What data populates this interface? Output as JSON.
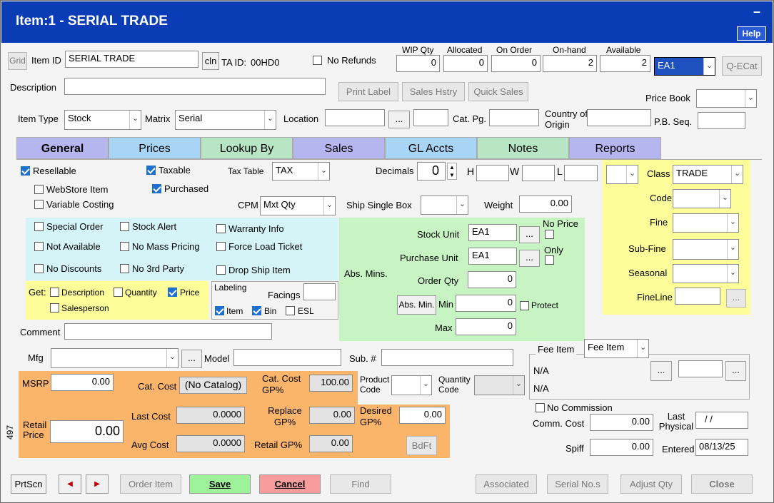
{
  "window": {
    "title": "Item:1 - SERIAL TRADE",
    "minimize": "–",
    "help": "Help"
  },
  "header": {
    "grid": "Grid",
    "item_id_label": "Item ID",
    "item_id": "SERIAL TRADE",
    "cln": "cln",
    "ta_id_label": "TA ID:",
    "ta_id": "00HD0",
    "no_refunds": "No Refunds",
    "description_label": "Description",
    "description": "",
    "item_type_label": "Item Type",
    "item_type": "Stock",
    "matrix_label": "Matrix",
    "matrix": "Serial",
    "location_label": "Location",
    "location_btn": "...",
    "cat_pg_label": "Cat. Pg.",
    "country_label": "Country of Origin",
    "pb_seq_label": "P.B. Seq.",
    "price_book_label": "Price Book",
    "qecat": "Q-ECat",
    "unit": "EA1"
  },
  "qty": {
    "wip_label": "WIP Qty",
    "wip": "0",
    "allocated_label": "Allocated",
    "allocated": "0",
    "onorder_label": "On Order",
    "onorder": "0",
    "onhand_label": "On-hand",
    "onhand": "2",
    "available_label": "Available",
    "available": "2"
  },
  "actions": {
    "print_label": "Print Label",
    "sales_hstry": "Sales Hstry",
    "quick_sales": "Quick Sales"
  },
  "tabs": [
    {
      "label": "General",
      "color": "#b5b5ef"
    },
    {
      "label": "Prices",
      "color": "#a8d4f5"
    },
    {
      "label": "Lookup By",
      "color": "#b8e6c4"
    },
    {
      "label": "Sales",
      "color": "#b5b5ef"
    },
    {
      "label": "GL Accts",
      "color": "#a8d4f5"
    },
    {
      "label": "Notes",
      "color": "#b8e6c4"
    },
    {
      "label": "Reports",
      "color": "#b5b5ef"
    }
  ],
  "general": {
    "resellable": "Resellable",
    "taxable": "Taxable",
    "tax_table_label": "Tax Table",
    "tax_table": "TAX",
    "decimals_label": "Decimals",
    "decimals": "0",
    "h": "H",
    "w": "W",
    "l": "L",
    "webstore": "WebStore Item",
    "purchased": "Purchased",
    "variable_costing": "Variable Costing",
    "cpm_label": "CPM",
    "cpm": "Mxt Qty",
    "ship_single_box": "Ship Single Box",
    "weight_label": "Weight",
    "weight": "0.00",
    "special_order": "Special Order",
    "stock_alert": "Stock Alert",
    "warranty_info": "Warranty Info",
    "not_available": "Not Available",
    "no_mass_pricing": "No Mass Pricing",
    "force_load_ticket": "Force Load Ticket",
    "no_discounts": "No Discounts",
    "no_3rd_party": "No 3rd Party",
    "drop_ship": "Drop Ship Item",
    "get_label": "Get:",
    "get_description": "Description",
    "get_quantity": "Quantity",
    "get_price": "Price",
    "get_salesperson": "Salesperson",
    "labeling_label": "Labeling",
    "facings_label": "Facings",
    "lab_item": "Item",
    "lab_bin": "Bin",
    "lab_esl": "ESL",
    "comment_label": "Comment",
    "mfg_label": "Mfg",
    "model_label": "Model",
    "sub_label": "Sub. #"
  },
  "absmins": {
    "label": "Abs. Mins.",
    "stock_unit_label": "Stock Unit",
    "stock_unit": "EA1",
    "purchase_unit_label": "Purchase Unit",
    "purchase_unit": "EA1",
    "no_price": "No Price",
    "only": "Only",
    "order_qty_label": "Order Qty",
    "order_qty": "0",
    "absmin_btn": "Abs. Min.",
    "min_label": "Min",
    "min": "0",
    "protect": "Protect",
    "max_label": "Max",
    "max": "0"
  },
  "classif": {
    "class_label": "Class",
    "class": "TRADE",
    "code_label": "Code",
    "fine_label": "Fine",
    "subfine_label": "Sub-Fine",
    "seasonal_label": "Seasonal",
    "fineline_label": "FineLine"
  },
  "pricing": {
    "msrp_label": "MSRP",
    "msrp": "0.00",
    "cat_cost_label": "Cat. Cost",
    "cat_cost": "(No Catalog)",
    "cat_cost_gp_label": "Cat. Cost GP%",
    "cat_cost_gp": "100.00",
    "product_code_label": "Product Code",
    "quantity_code_label": "Quantity Code",
    "retail_price_label": "Retail Price",
    "retail_price": "0.00",
    "last_cost_label": "Last Cost",
    "last_cost": "0.0000",
    "replace_gp_label": "Replace GP%",
    "replace_gp": "0.00",
    "desired_gp_label": "Desired GP%",
    "desired_gp": "0.00",
    "avg_cost_label": "Avg Cost",
    "avg_cost": "0.0000",
    "retail_gp_label": "Retail GP%",
    "retail_gp": "0.00",
    "bdft": "BdFt",
    "side": "497"
  },
  "fee": {
    "fee_item_label": "Fee Item",
    "fee_item": "Fee Item",
    "na1": "N/A",
    "na2": "N/A",
    "no_commission": "No Commission",
    "comm_cost_label": "Comm. Cost",
    "comm_cost": "0.00",
    "last_physical_label": "Last Physical",
    "last_physical": "/ /",
    "spiff_label": "Spiff",
    "spiff": "0.00",
    "entered_label": "Entered",
    "entered": "08/13/25"
  },
  "footer": {
    "prtscn": "PrtScn",
    "prev": "◀",
    "next": "▶",
    "order_item": "Order Item",
    "save": "Save",
    "cancel": "Cancel",
    "find": "Find",
    "associated": "Associated",
    "serial_nos": "Serial No.s",
    "adjust_qty": "Adjust Qty",
    "close": "Close"
  }
}
